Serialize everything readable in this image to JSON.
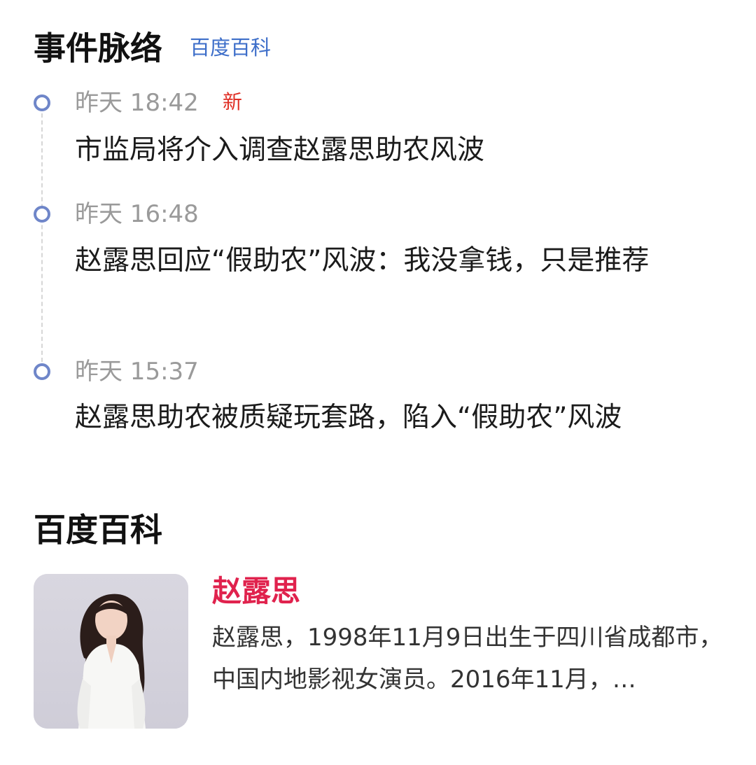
{
  "events_section": {
    "title": "事件脉络",
    "source_link": "百度百科",
    "items": [
      {
        "time": "昨天 18:42",
        "badge": "新",
        "title": "市监局将介入调查赵露思助农风波"
      },
      {
        "time": "昨天 16:48",
        "badge": "",
        "title": "赵露思回应“假助农”风波：我没拿钱，只是推荐"
      },
      {
        "time": "昨天 15:37",
        "badge": "",
        "title": "赵露思助农被质疑玩套路，陷入“假助农”风波"
      }
    ]
  },
  "baike_section": {
    "title": "百度百科",
    "card": {
      "name": "赵露思",
      "description": "赵露思，1998年11月9日出生于四川省成都市，中国内地影视女演员。2016年11月，…"
    }
  },
  "colors": {
    "accent_blue": "#3d6ec9",
    "timeline_dot": "#6f86c9",
    "new_badge": "#e02e24",
    "name_red": "#e0224d"
  }
}
